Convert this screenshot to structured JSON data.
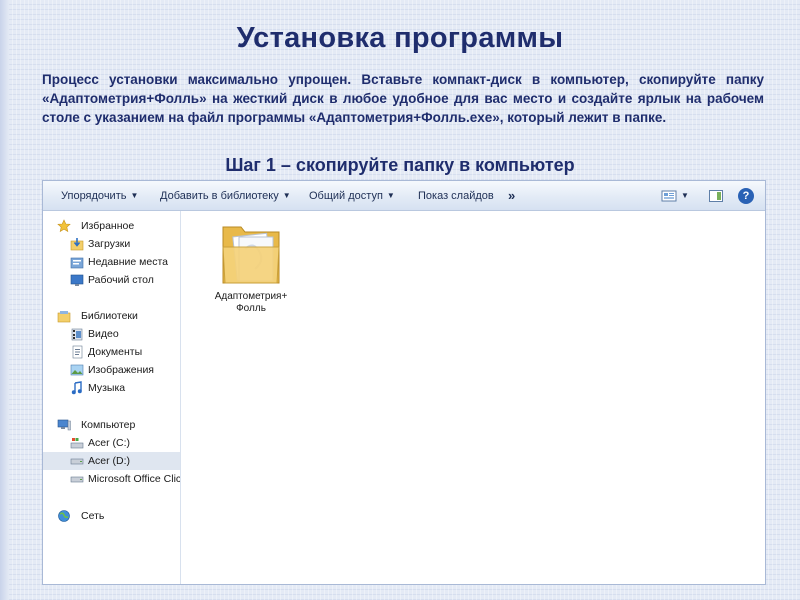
{
  "slide": {
    "title": "Установка программы",
    "intro": "Процесс установки максимально упрощен. Вставьте компакт-диск в компьютер, скопируйте папку «Адаптометрия+Фолль» на жесткий диск в любое удобное для вас место и создайте ярлык на рабочем столе с указанием на файл программы «Адаптометрия+Фолль.exe», который лежит в папке.",
    "step_caption": "Шаг 1 – скопируйте папку в компьютер"
  },
  "explorer": {
    "toolbar": {
      "organize": "Упорядочить",
      "add_to_library": "Добавить в библиотеку",
      "share": "Общий доступ",
      "slideshow": "Показ слайдов",
      "more": "»",
      "help": "?"
    },
    "nav": {
      "favorites": "Избранное",
      "downloads": "Загрузки",
      "recent": "Недавние места",
      "desktop": "Рабочий стол",
      "libraries": "Библиотеки",
      "video": "Видео",
      "documents": "Документы",
      "pictures": "Изображения",
      "music": "Музыка",
      "computer": "Компьютер",
      "drive_c": "Acer (C:)",
      "drive_d": "Acer (D:)",
      "office": "Microsoft Office Clic",
      "network": "Сеть"
    },
    "folder_label": "Адаптометрия+ Фолль"
  },
  "colors": {
    "heading": "#1f2d6d",
    "selection": "#dfe6f0",
    "folder": "#f5d27a"
  }
}
